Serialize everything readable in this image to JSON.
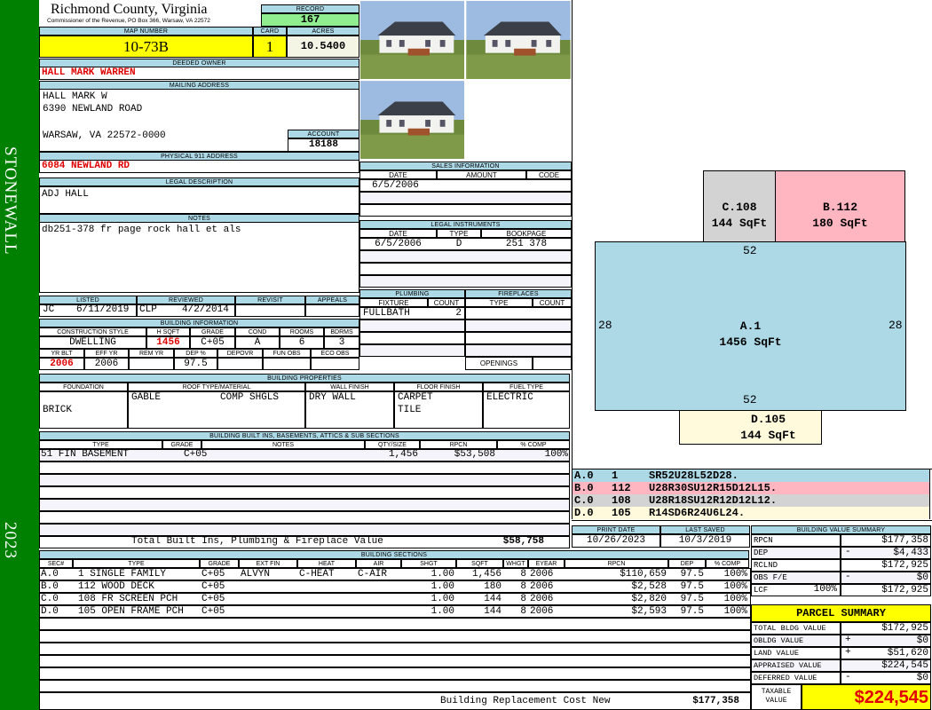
{
  "sidebar": {
    "district": "STONEWALL",
    "year": "2023"
  },
  "header": {
    "county": "Richmond County, Virginia",
    "subtitle": "Commissioner of the Revenue, PO Box 366, Warsaw, VA 22572",
    "record_label": "RECORD",
    "record": "167"
  },
  "parcel": {
    "map_label": "MAP NUMBER",
    "map": "10-73B",
    "card_label": "CARD",
    "card": "1",
    "acres_label": "ACRES",
    "acres": "10.5400"
  },
  "owner": {
    "label": "DEEDED OWNER",
    "name": "HALL MARK WARREN"
  },
  "mailing": {
    "label": "MAILING ADDRESS",
    "line1": "HALL MARK W",
    "line2": "6390 NEWLAND ROAD",
    "line3": "WARSAW, VA 22572-0000",
    "account_label": "ACCOUNT",
    "account": "18188"
  },
  "physical": {
    "label": "PHYSICAL 911 ADDRESS",
    "value": "6084 NEWLAND RD"
  },
  "legal": {
    "label": "LEGAL DESCRIPTION",
    "value": "ADJ HALL"
  },
  "notes": {
    "label": "NOTES",
    "value": "db251-378 fr page rock hall et als"
  },
  "review": {
    "listed_label": "LISTED",
    "listed_by": "JC",
    "listed_date": "6/11/2019",
    "reviewed_label": "REVIEWED",
    "reviewed_by": "CLP",
    "reviewed_date": "4/2/2014",
    "revisit_label": "REVISIT",
    "appeals_label": "APPEALS"
  },
  "bldg_info": {
    "label": "BUILDING INFORMATION",
    "headers1": [
      "CONSTRUCTION STYLE",
      "H SQFT",
      "GRADE",
      "COND",
      "ROOMS",
      "BDRMS"
    ],
    "values1": [
      "DWELLING",
      "1456",
      "C+05",
      "A",
      "6",
      "3"
    ],
    "headers2": [
      "YR BLT",
      "EFF YR",
      "REM YR",
      "DEP %",
      "DEPOVR",
      "FUN OBS",
      "ECO OBS"
    ],
    "values2": [
      "2006",
      "2006",
      "",
      "97.5",
      "",
      "",
      ""
    ]
  },
  "sales": {
    "label": "SALES INFORMATION",
    "headers": [
      "DATE",
      "AMOUNT",
      "CODE"
    ],
    "rows": [
      [
        "6/5/2006",
        "",
        ""
      ]
    ]
  },
  "instruments": {
    "label": "LEGAL INSTRUMENTS",
    "headers": [
      "DATE",
      "TYPE",
      "BOOKPAGE"
    ],
    "rows": [
      [
        "6/5/2006",
        "D",
        "251 378"
      ]
    ]
  },
  "plumbing": {
    "label": "PLUMBING",
    "headers": [
      "FIXTURE",
      "COUNT"
    ],
    "rows": [
      [
        "FULLBATH",
        "2"
      ]
    ]
  },
  "fireplaces": {
    "label": "FIREPLACES",
    "headers": [
      "TYPE",
      "COUNT"
    ],
    "openings_label": "OPENINGS"
  },
  "properties": {
    "label": "BUILDING PROPERTIES",
    "headers": [
      "FOUNDATION",
      "ROOF TYPE/MATERIAL",
      "WALL FINISH",
      "FLOOR FINISH",
      "FUEL TYPE"
    ],
    "foundation": "BRICK",
    "roof_type": "GABLE",
    "roof_material": "COMP SHGLS",
    "wall": "DRY WALL",
    "floor1": "CARPET",
    "floor2": "TILE",
    "fuel": "ELECTRIC"
  },
  "builtins": {
    "label": "BUILDING BUILT INS, BASEMENTS, ATTICS & SUB SECTIONS",
    "headers": [
      "TYPE",
      "GRADE",
      "NOTES",
      "QTY/SIZE",
      "RPCN",
      "% COMP"
    ],
    "rows": [
      [
        "51 FIN BASEMENT",
        "C+05",
        "",
        "1,456",
        "$53,508",
        "100%"
      ]
    ],
    "total_label": "Total Built Ins, Plumbing & Fireplace Value",
    "total": "$58,758"
  },
  "sections": {
    "label": "BUILDING SECTIONS",
    "headers": [
      "SEC#",
      "TYPE",
      "GRADE",
      "EXT FIN",
      "HEAT",
      "AIR",
      "SHGT",
      "SQFT",
      "WHGT",
      "EYEAR",
      "RPCN",
      "DEP",
      "% COMP"
    ],
    "rows": [
      [
        "A.0",
        "1 SINGLE FAMILY",
        "C+05",
        "ALVYN",
        "C-HEAT",
        "C-AIR",
        "1.00",
        "1,456",
        "8",
        "2006",
        "$110,659",
        "97.5",
        "100%"
      ],
      [
        "B.0",
        "112 WOOD DECK",
        "C+05",
        "",
        "",
        "",
        "1.00",
        "180",
        "8",
        "2006",
        "$2,528",
        "97.5",
        "100%"
      ],
      [
        "C.0",
        "108 FR SCREEN PCH",
        "C+05",
        "",
        "",
        "",
        "1.00",
        "144",
        "8",
        "2006",
        "$2,820",
        "97.5",
        "100%"
      ],
      [
        "D.0",
        "105 OPEN FRAME PCH",
        "C+05",
        "",
        "",
        "",
        "1.00",
        "144",
        "8",
        "2006",
        "$2,593",
        "97.5",
        "100%"
      ]
    ],
    "total_label": "Building Replacement Cost New",
    "total": "$177,358"
  },
  "sketch": {
    "areas": {
      "A": {
        "code": "A.1",
        "sqft": "1456 SqFt"
      },
      "B": {
        "code": "B.112",
        "sqft": "180 SqFt"
      },
      "C": {
        "code": "C.108",
        "sqft": "144 SqFt"
      },
      "D": {
        "code": "D.105",
        "sqft": "144 SqFt"
      }
    },
    "dims": {
      "top": "52",
      "bottom": "52",
      "left": "28",
      "right": "28"
    },
    "codes": [
      [
        "A.0",
        "1",
        "SR52U28L52D28."
      ],
      [
        "B.0",
        "112",
        "U28R30SU12R15D12L15."
      ],
      [
        "C.0",
        "108",
        "U28R18SU12R12D12L12."
      ],
      [
        "D.0",
        "105",
        "R14SD6R24U6L24."
      ]
    ],
    "colors": {
      "A": "#add8e6",
      "B": "#ffb6c1",
      "C": "#d3d3d3",
      "D": "#fffadc"
    }
  },
  "dates": {
    "print_label": "PRINT DATE",
    "print": "10/26/2023",
    "saved_label": "LAST SAVED",
    "saved": "10/3/2019"
  },
  "value_summary": {
    "label": "BUILDING VALUE SUMMARY",
    "lcf_pct": "100%",
    "rows": [
      {
        "label": "RPCN",
        "sign": "",
        "value": "$177,358"
      },
      {
        "label": "DEP",
        "sign": "-",
        "value": "$4,433"
      },
      {
        "label": "RCLND",
        "sign": "",
        "value": "$172,925"
      },
      {
        "label": "OBS F/E",
        "sign": "-",
        "value": "$0"
      },
      {
        "label": "LCF",
        "sign": "",
        "value": "$172,925"
      }
    ]
  },
  "parcel_summary": {
    "title": "PARCEL SUMMARY",
    "rows": [
      {
        "label": "TOTAL BLDG VALUE",
        "sign": "",
        "value": "$172,925"
      },
      {
        "label": "OBLDG VALUE",
        "sign": "+",
        "value": "$0"
      },
      {
        "label": "LAND VALUE",
        "sign": "+",
        "value": "$51,620"
      },
      {
        "label": "APPRAISED VALUE",
        "sign": "",
        "value": "$224,545"
      },
      {
        "label": "DEFERRED VALUE",
        "sign": "-",
        "value": "$0"
      }
    ],
    "taxable_label": "TAXABLE VALUE",
    "taxable": "$224,545"
  }
}
